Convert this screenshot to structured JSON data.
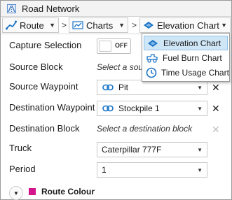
{
  "window": {
    "title": "Road Network"
  },
  "breadcrumb": [
    {
      "label": "Route",
      "icon": "route-icon"
    },
    {
      "label": "Charts",
      "icon": "folder-icon"
    },
    {
      "label": "Elevation Chart",
      "icon": "elevation-chart-icon"
    }
  ],
  "breadcrumb_separator": ">",
  "form": {
    "capture_selection": {
      "label": "Capture Selection",
      "state": "OFF"
    },
    "source_block": {
      "label": "Source Block",
      "hint": "Select a source block"
    },
    "source_waypoint": {
      "label": "Source Waypoint",
      "value": "Pit"
    },
    "destination_waypoint": {
      "label": "Destination Waypoint",
      "value": "Stockpile 1"
    },
    "destination_block": {
      "label": "Destination Block",
      "hint": "Select a destination block"
    },
    "truck": {
      "label": "Truck",
      "value": "Caterpillar 777F"
    },
    "period": {
      "label": "Period",
      "value": "1"
    }
  },
  "clear_glyph": "✕",
  "section": {
    "label": "Route Colour",
    "swatch_color": "#d4148c"
  },
  "chart_menu": {
    "items": [
      {
        "label": "Elevation Chart",
        "icon": "elevation-chart-icon",
        "selected": true
      },
      {
        "label": "Fuel Burn Chart",
        "icon": "fuel-truck-icon",
        "selected": false
      },
      {
        "label": "Time Usage Chart",
        "icon": "clock-icon",
        "selected": false
      }
    ]
  },
  "colors": {
    "accent": "#1a73c7",
    "selection_bg": "#cfe6f7",
    "selection_border": "#8fc2e9"
  }
}
